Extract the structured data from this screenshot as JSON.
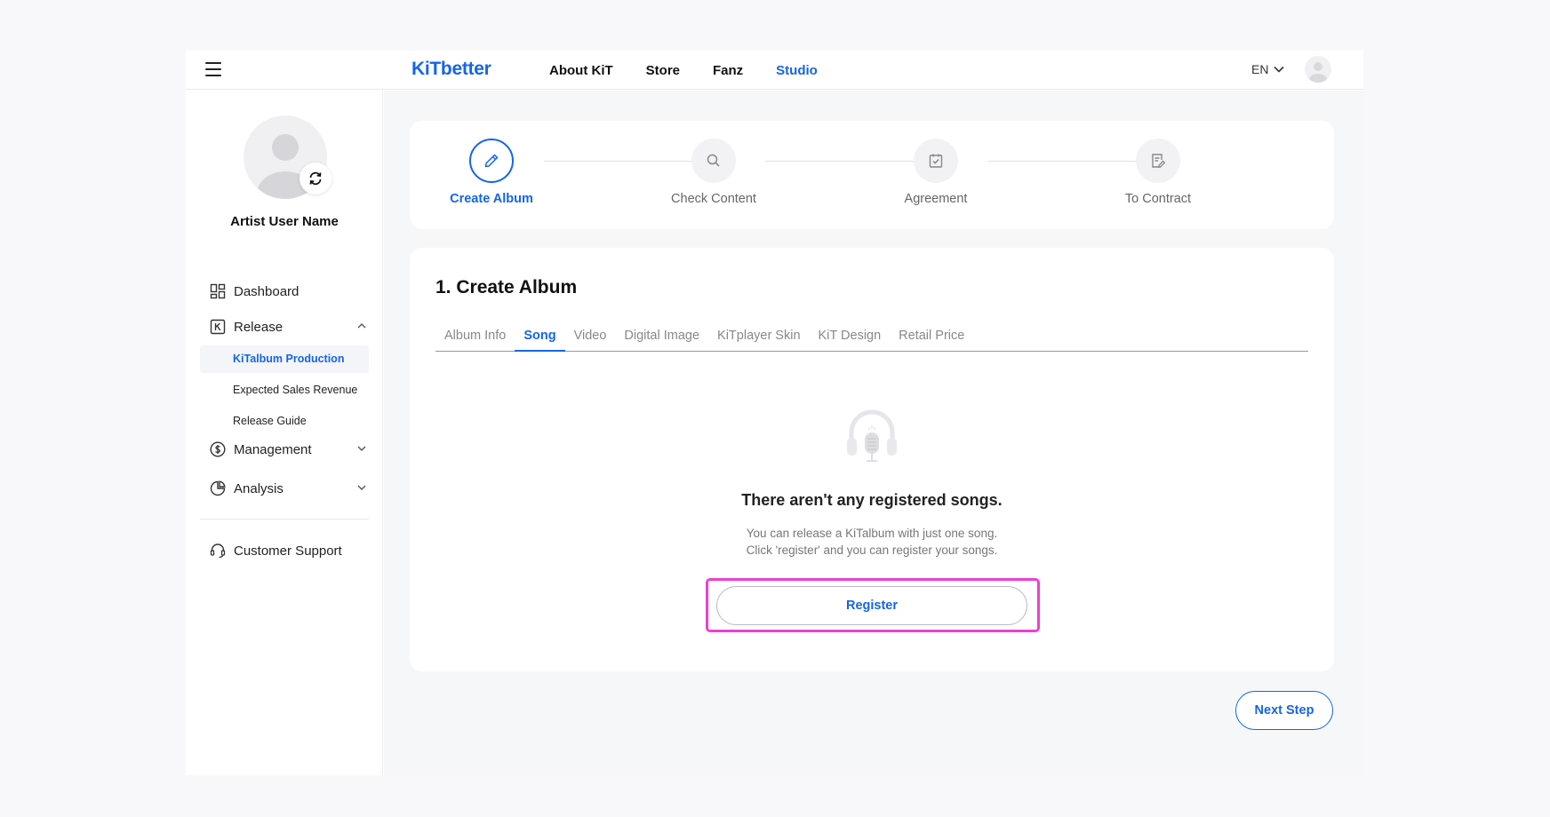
{
  "header": {
    "logo": "KiTbetter",
    "nav": [
      "About KiT",
      "Store",
      "Fanz",
      "Studio"
    ],
    "active_nav": "Studio",
    "language": "EN"
  },
  "sidebar": {
    "artist_name": "Artist User Name",
    "items": {
      "dashboard": "Dashboard",
      "release": "Release",
      "management": "Management",
      "analysis": "Analysis",
      "customer_support": "Customer Support"
    },
    "release_sub": [
      "KiTalbum Production",
      "Expected Sales Revenue",
      "Release Guide"
    ],
    "active_sub": "KiTalbum Production"
  },
  "stepper": {
    "steps": [
      "Create Album",
      "Check Content",
      "Agreement",
      "To Contract"
    ],
    "active_step": "Create Album"
  },
  "content": {
    "section_number": "1.",
    "section_title": "Create Album",
    "tabs": [
      "Album Info",
      "Song",
      "Video",
      "Digital Image",
      "KiTplayer Skin",
      "KiT Design",
      "Retail Price"
    ],
    "active_tab": "Song",
    "empty_title": "There aren't any registered songs.",
    "empty_line1": "You can release a KiTalbum with just one song.",
    "empty_line2": "Click 'register' and you can register your songs.",
    "register_label": "Register",
    "next_label": "Next Step"
  },
  "colors": {
    "accent": "#1565e6",
    "highlight": "#ee3fd0"
  }
}
